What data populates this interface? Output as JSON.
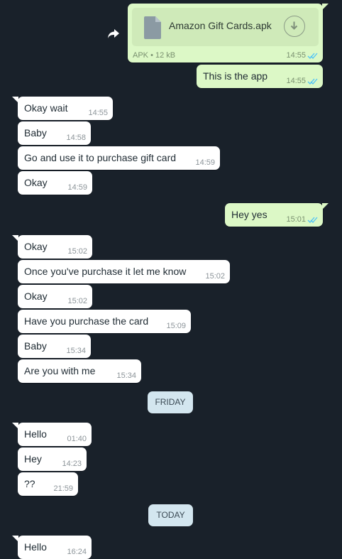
{
  "file_message": {
    "file_name": "Amazon Gift Cards.apk",
    "file_meta": "APK • 12 kB",
    "time": "14:55"
  },
  "messages": [
    {
      "dir": "out",
      "text": "This is the app",
      "time": "14:55"
    },
    {
      "dir": "in",
      "text": "Okay wait",
      "time": "14:55"
    },
    {
      "dir": "in",
      "text": "Baby",
      "time": "14:58"
    },
    {
      "dir": "in",
      "text": "Go and use it to purchase gift card",
      "time": "14:59"
    },
    {
      "dir": "in",
      "text": "Okay",
      "time": "14:59"
    },
    {
      "dir": "out",
      "text": "Hey yes",
      "time": "15:01"
    },
    {
      "dir": "in",
      "text": "Okay",
      "time": "15:02"
    },
    {
      "dir": "in",
      "text": "Once you've purchase it let me know",
      "time": "15:02"
    },
    {
      "dir": "in",
      "text": "Okay",
      "time": "15:02"
    },
    {
      "dir": "in",
      "text": "Have you purchase the card",
      "time": "15:09"
    },
    {
      "dir": "in",
      "text": "Baby",
      "time": "15:34"
    },
    {
      "dir": "in",
      "text": "Are you with me",
      "time": "15:34"
    },
    {
      "dir": "in",
      "text": "Hello",
      "time": "01:40"
    },
    {
      "dir": "in",
      "text": "Hey",
      "time": "14:23"
    },
    {
      "dir": "in",
      "text": "??",
      "time": "21:59"
    },
    {
      "dir": "in",
      "text": "Hello",
      "time": "16:24"
    }
  ],
  "day_separators": [
    "FRIDAY",
    "TODAY"
  ],
  "colors": {
    "background": "#19212a",
    "incoming_bubble": "#ffffff",
    "outgoing_bubble": "#dcf8c6",
    "read_ticks": "#4fc3f7",
    "day_separator": "#d3e6ef"
  },
  "icons": [
    "forward-icon",
    "document-icon",
    "download-icon",
    "double-check-icon"
  ]
}
